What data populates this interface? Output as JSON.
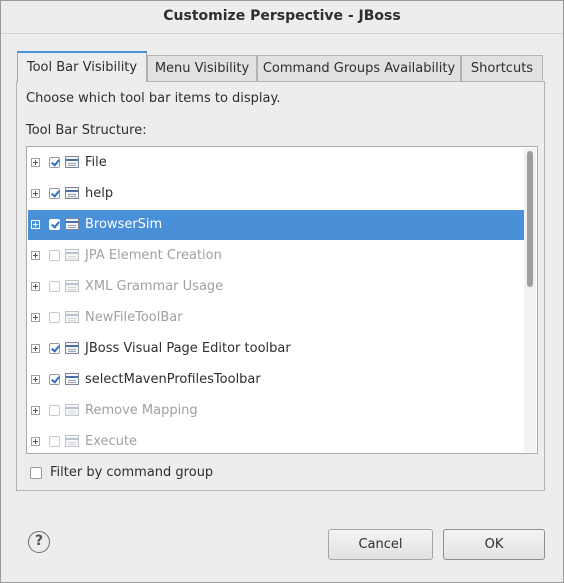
{
  "dialog": {
    "title": "Customize Perspective - JBoss"
  },
  "tabs": [
    {
      "label": "Tool Bar Visibility",
      "active": true
    },
    {
      "label": "Menu Visibility",
      "active": false
    },
    {
      "label": "Command Groups Availability",
      "active": false
    },
    {
      "label": "Shortcuts",
      "active": false
    }
  ],
  "panel": {
    "description": "Choose which tool bar items to display.",
    "structure_label": "Tool Bar Structure:"
  },
  "tree": {
    "items": [
      {
        "label": "File",
        "checked": true,
        "enabled": true,
        "selected": false
      },
      {
        "label": "help",
        "checked": true,
        "enabled": true,
        "selected": false
      },
      {
        "label": "BrowserSim",
        "checked": true,
        "enabled": true,
        "selected": true
      },
      {
        "label": "JPA Element Creation",
        "checked": false,
        "enabled": false,
        "selected": false
      },
      {
        "label": "XML Grammar Usage",
        "checked": false,
        "enabled": false,
        "selected": false
      },
      {
        "label": "NewFileToolBar",
        "checked": false,
        "enabled": false,
        "selected": false
      },
      {
        "label": "JBoss Visual Page Editor toolbar",
        "checked": true,
        "enabled": true,
        "selected": false
      },
      {
        "label": "selectMavenProfilesToolbar",
        "checked": true,
        "enabled": true,
        "selected": false
      },
      {
        "label": "Remove Mapping",
        "checked": false,
        "enabled": false,
        "selected": false
      },
      {
        "label": "Execute",
        "checked": false,
        "enabled": false,
        "selected": false
      }
    ]
  },
  "filter": {
    "label": "Filter by command group",
    "checked": false
  },
  "buttons": {
    "help_label": "?",
    "cancel_label": "Cancel",
    "ok_label": "OK"
  },
  "colors": {
    "selection": "#4a90d9",
    "check": "#2c6fbf"
  }
}
